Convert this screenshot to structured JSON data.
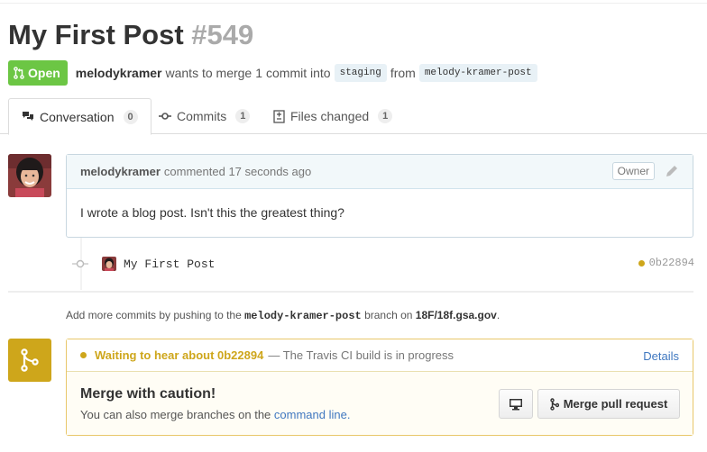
{
  "pr": {
    "title": "My First Post",
    "number": "#549",
    "state": "Open",
    "author": "melodykramer",
    "action_text": "wants to merge",
    "commit_count": "1",
    "commit_word": "commit into",
    "base_branch": "staging",
    "from_word": "from",
    "head_branch": "melody-kramer-post"
  },
  "tabs": [
    {
      "label": "Conversation",
      "count": "0",
      "icon": "comment-discussion-icon"
    },
    {
      "label": "Commits",
      "count": "1",
      "icon": "git-commit-icon"
    },
    {
      "label": "Files changed",
      "count": "1",
      "icon": "diff-icon"
    }
  ],
  "comment": {
    "author": "melodykramer",
    "verb": "commented",
    "time": "17 seconds ago",
    "badge": "Owner",
    "body": "I wrote a blog post. Isn't this the greatest thing?"
  },
  "commit": {
    "message": "My First Post",
    "sha": "0b22894"
  },
  "push_note": {
    "prefix": "Add more commits by pushing to the",
    "branch": "melody-kramer-post",
    "middle": "branch on",
    "repo": "18F/18f.gsa.gov",
    "suffix": "."
  },
  "merge": {
    "status_pending": "Waiting to hear about 0b22894",
    "status_text": "— The Travis CI build is in progress",
    "details_link": "Details",
    "caution_title": "Merge with caution!",
    "caution_sub": "You can also merge branches on the",
    "command_line_link": "command line.",
    "merge_button": "Merge pull request"
  },
  "colors": {
    "open_green": "#6cc644",
    "pending_yellow": "#cea61b",
    "link_blue": "#4078c0"
  }
}
